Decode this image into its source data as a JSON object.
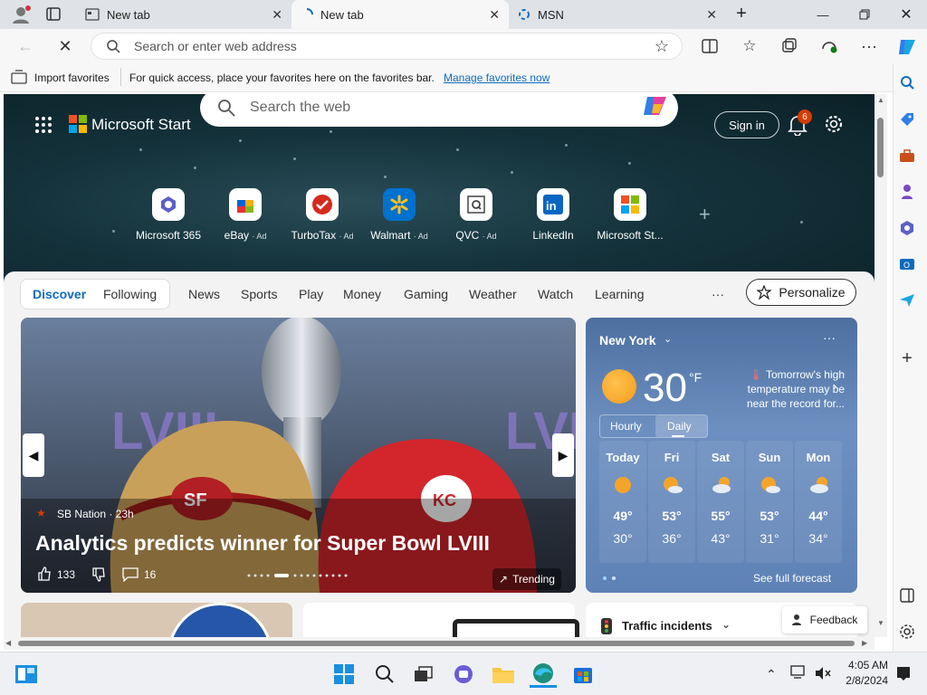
{
  "tabs": [
    {
      "title": "New tab"
    },
    {
      "title": "New tab"
    },
    {
      "title": "MSN"
    }
  ],
  "address": {
    "placeholder": "Search or enter web address"
  },
  "favorites_bar": {
    "import_label": "Import favorites",
    "message": "For quick access, place your favorites here on the favorites bar.",
    "manage_link": "Manage favorites now"
  },
  "msn": {
    "brand": "Microsoft Start",
    "search_placeholder": "Search the web",
    "sign_in": "Sign in",
    "notification_count": "6",
    "quick_links": [
      {
        "label": "Microsoft 365",
        "ad": ""
      },
      {
        "label": "eBay",
        "ad": "· Ad"
      },
      {
        "label": "TurboTax",
        "ad": "· Ad"
      },
      {
        "label": "Walmart",
        "ad": "· Ad"
      },
      {
        "label": "QVC",
        "ad": "· Ad"
      },
      {
        "label": "LinkedIn",
        "ad": ""
      },
      {
        "label": "Microsoft St...",
        "ad": ""
      }
    ],
    "nav": [
      "Discover",
      "Following",
      "News",
      "Sports",
      "Play",
      "Money",
      "Gaming",
      "Weather",
      "Watch",
      "Learning"
    ],
    "more": "···",
    "personalize": "Personalize",
    "hero": {
      "source": "SB Nation · 23h",
      "headline": "Analytics predicts winner for Super Bowl LVIII",
      "likes": "133",
      "comments": "16",
      "trending": "Trending"
    },
    "weather": {
      "city": "New York",
      "temp": "30",
      "unit": "°F",
      "note": "Tomorrow's high temperature may be near the record for...",
      "tabs": [
        "Hourly",
        "Daily"
      ],
      "days": [
        {
          "day": "Today",
          "hi": "49°",
          "lo": "30°"
        },
        {
          "day": "Fri",
          "hi": "53°",
          "lo": "36°"
        },
        {
          "day": "Sat",
          "hi": "55°",
          "lo": "43°"
        },
        {
          "day": "Sun",
          "hi": "53°",
          "lo": "31°"
        },
        {
          "day": "Mon",
          "hi": "44°",
          "lo": "34°"
        }
      ],
      "see_full": "See full forecast"
    },
    "traffic": "Traffic incidents",
    "feedback": "Feedback"
  },
  "taskbar": {
    "time": "4:05 AM",
    "date": "2/8/2024"
  },
  "colors": {
    "accent": "#0f6cbd",
    "weather_bg": "#5f82b6",
    "hero_bg": "#14323b"
  }
}
